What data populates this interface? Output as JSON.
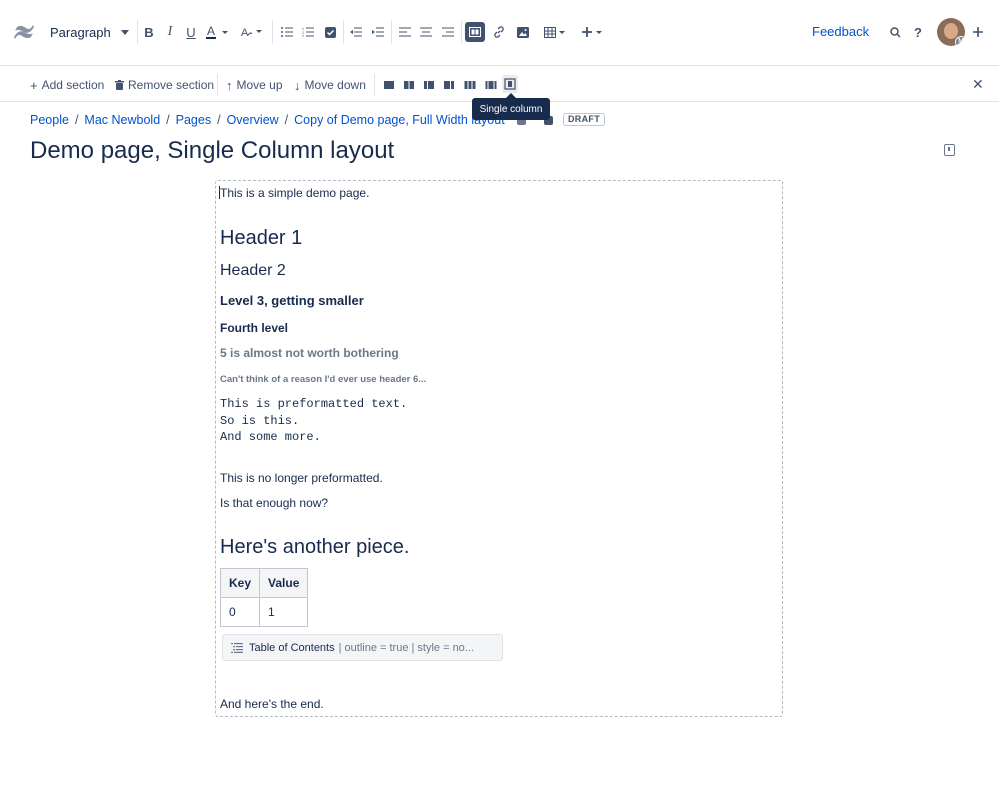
{
  "toolbar": {
    "paragraph_label": "Paragraph",
    "feedback_label": "Feedback",
    "avatar_badge": "M"
  },
  "section_toolbar": {
    "add_section": "Add section",
    "remove_section": "Remove section",
    "move_up": "Move up",
    "move_down": "Move down",
    "tooltip": "Single column"
  },
  "breadcrumb": {
    "items": [
      "People",
      "Mac Newbold",
      "Pages",
      "Overview",
      "Copy of Demo page, Full Width layout"
    ],
    "separator": "/"
  },
  "draft_badge": "DRAFT",
  "page_title": "Demo page, Single Column layout",
  "content": {
    "intro": "This is a simple demo page.",
    "h1": "Header 1",
    "h2": "Header 2",
    "h3": "Level 3, getting smaller",
    "h4": "Fourth level",
    "h5": "5 is almost not worth bothering",
    "h6": "Can't think of a reason I'd ever use header 6...",
    "pre": "This is preformatted text.\nSo is this.\nAnd some more.",
    "p1": "This is no longer preformatted.",
    "p2": "Is that enough now?",
    "h1b": "Here's another piece.",
    "table": {
      "headers": [
        "Key",
        "Value"
      ],
      "rows": [
        [
          "0",
          "1"
        ]
      ]
    },
    "macro": {
      "name": "Table of Contents",
      "params": "| outline = true | style = no..."
    },
    "end": "And here's the end."
  },
  "colors": {
    "link": "#0052cc",
    "text": "#172b4d",
    "icon": "#42526e"
  }
}
